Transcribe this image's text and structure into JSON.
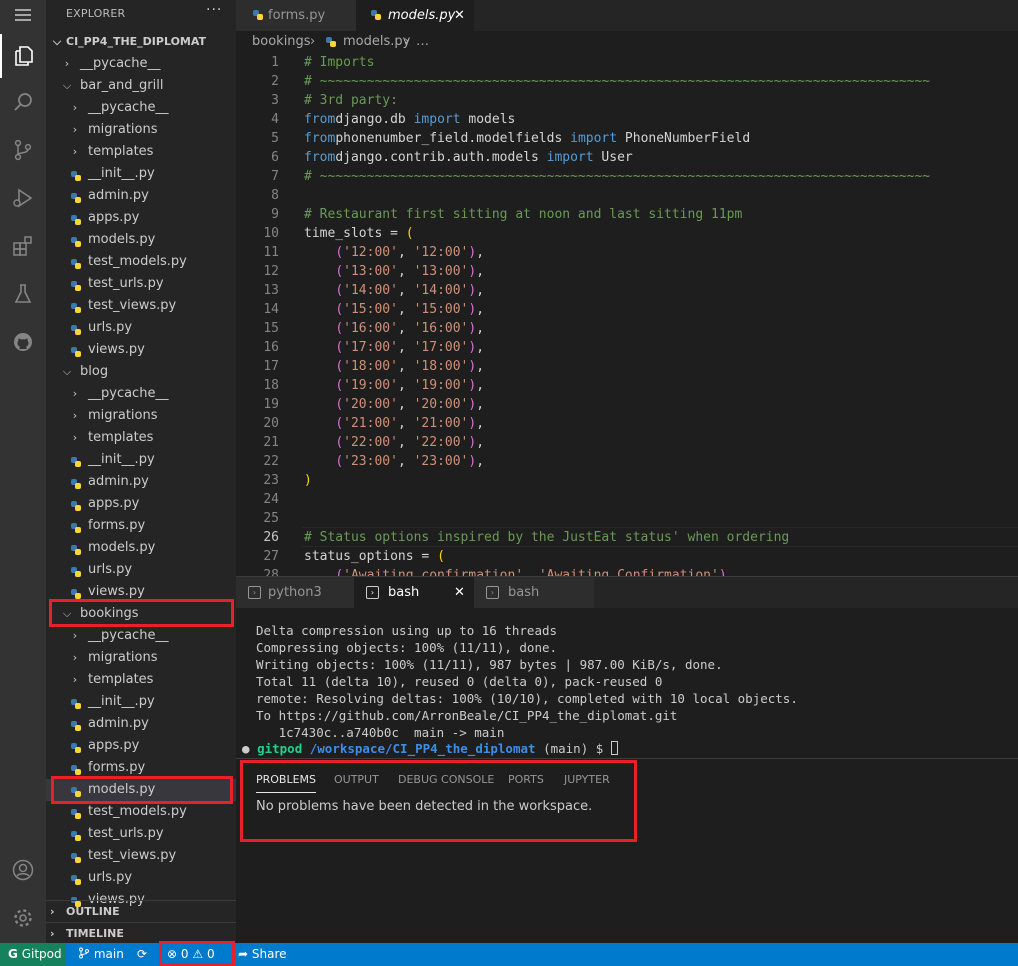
{
  "explorer": {
    "title": "EXPLORER",
    "more": "···",
    "root": "CI_PP4_THE_DIPLOMAT",
    "tree": [
      {
        "label": "__pycache__",
        "type": "folder",
        "open": false,
        "depth": 1
      },
      {
        "label": "bar_and_grill",
        "type": "folder",
        "open": true,
        "depth": 1
      },
      {
        "label": "__pycache__",
        "type": "folder",
        "open": false,
        "depth": 2
      },
      {
        "label": "migrations",
        "type": "folder",
        "open": false,
        "depth": 2
      },
      {
        "label": "templates",
        "type": "folder",
        "open": false,
        "depth": 2
      },
      {
        "label": "__init__.py",
        "type": "file",
        "depth": 2
      },
      {
        "label": "admin.py",
        "type": "file",
        "depth": 2
      },
      {
        "label": "apps.py",
        "type": "file",
        "depth": 2
      },
      {
        "label": "models.py",
        "type": "file",
        "depth": 2
      },
      {
        "label": "test_models.py",
        "type": "file",
        "depth": 2
      },
      {
        "label": "test_urls.py",
        "type": "file",
        "depth": 2
      },
      {
        "label": "test_views.py",
        "type": "file",
        "depth": 2
      },
      {
        "label": "urls.py",
        "type": "file",
        "depth": 2
      },
      {
        "label": "views.py",
        "type": "file",
        "depth": 2
      },
      {
        "label": "blog",
        "type": "folder",
        "open": true,
        "depth": 1
      },
      {
        "label": "__pycache__",
        "type": "folder",
        "open": false,
        "depth": 2
      },
      {
        "label": "migrations",
        "type": "folder",
        "open": false,
        "depth": 2
      },
      {
        "label": "templates",
        "type": "folder",
        "open": false,
        "depth": 2
      },
      {
        "label": "__init__.py",
        "type": "file",
        "depth": 2
      },
      {
        "label": "admin.py",
        "type": "file",
        "depth": 2
      },
      {
        "label": "apps.py",
        "type": "file",
        "depth": 2
      },
      {
        "label": "forms.py",
        "type": "file",
        "depth": 2
      },
      {
        "label": "models.py",
        "type": "file",
        "depth": 2
      },
      {
        "label": "urls.py",
        "type": "file",
        "depth": 2
      },
      {
        "label": "views.py",
        "type": "file",
        "depth": 2
      },
      {
        "label": "bookings",
        "type": "folder",
        "open": true,
        "depth": 1
      },
      {
        "label": "__pycache__",
        "type": "folder",
        "open": false,
        "depth": 2
      },
      {
        "label": "migrations",
        "type": "folder",
        "open": false,
        "depth": 2
      },
      {
        "label": "templates",
        "type": "folder",
        "open": false,
        "depth": 2
      },
      {
        "label": "__init__.py",
        "type": "file",
        "depth": 2
      },
      {
        "label": "admin.py",
        "type": "file",
        "depth": 2
      },
      {
        "label": "apps.py",
        "type": "file",
        "depth": 2
      },
      {
        "label": "forms.py",
        "type": "file",
        "depth": 2
      },
      {
        "label": "models.py",
        "type": "file",
        "depth": 2,
        "selected": true
      },
      {
        "label": "test_models.py",
        "type": "file",
        "depth": 2
      },
      {
        "label": "test_urls.py",
        "type": "file",
        "depth": 2
      },
      {
        "label": "test_views.py",
        "type": "file",
        "depth": 2
      },
      {
        "label": "urls.py",
        "type": "file",
        "depth": 2
      },
      {
        "label": "views.py",
        "type": "file",
        "depth": 2
      }
    ],
    "outline": "OUTLINE",
    "timeline": "TIMELINE"
  },
  "tabs": [
    {
      "label": "forms.py",
      "active": false
    },
    {
      "label": "models.py",
      "active": true,
      "close": "✕"
    }
  ],
  "breadcrumb": {
    "folder": "bookings",
    "sep": "›",
    "file": "models.py",
    "more": "…"
  },
  "editor": {
    "lines": [
      {
        "n": "1",
        "tokens": [
          [
            "cm",
            "# Imports"
          ]
        ]
      },
      {
        "n": "2",
        "tokens": [
          [
            "cm",
            "# ~~~~~~~~~~~~~~~~~~~~~~~~~~~~~~~~~~~~~~~~~~~~~~~~~~~~~~~~~~~~~~~~~~~~~~~~~~~~~~"
          ]
        ]
      },
      {
        "n": "3",
        "tokens": [
          [
            "cm",
            "# 3rd party:"
          ]
        ]
      },
      {
        "n": "4",
        "tokens": [
          [
            "kw",
            "from"
          ],
          [
            "",
            "django.db "
          ],
          [
            "kw",
            "import"
          ],
          [
            "",
            " models"
          ]
        ]
      },
      {
        "n": "5",
        "tokens": [
          [
            "kw",
            "from"
          ],
          [
            "",
            "phonenumber_field.modelfields "
          ],
          [
            "kw",
            "import"
          ],
          [
            "",
            " PhoneNumberField"
          ]
        ]
      },
      {
        "n": "6",
        "tokens": [
          [
            "kw",
            "from"
          ],
          [
            "",
            "django.contrib.auth.models "
          ],
          [
            "kw",
            "import"
          ],
          [
            "",
            " User"
          ]
        ]
      },
      {
        "n": "7",
        "tokens": [
          [
            "cm",
            "# ~~~~~~~~~~~~~~~~~~~~~~~~~~~~~~~~~~~~~~~~~~~~~~~~~~~~~~~~~~~~~~~~~~~~~~~~~~~~~~"
          ]
        ]
      },
      {
        "n": "8",
        "tokens": []
      },
      {
        "n": "9",
        "tokens": [
          [
            "cm",
            "# Restaurant first sitting at noon and last sitting 11pm"
          ]
        ]
      },
      {
        "n": "10",
        "tokens": [
          [
            "",
            "time_slots = "
          ],
          [
            "py2",
            "("
          ]
        ]
      },
      {
        "n": "11",
        "tokens": [
          [
            "",
            "    "
          ],
          [
            "pu",
            "("
          ],
          [
            "st",
            "'12:00'"
          ],
          [
            "",
            ", "
          ],
          [
            "st",
            "'12:00'"
          ],
          [
            "pu",
            ")"
          ],
          [
            "",
            ","
          ]
        ]
      },
      {
        "n": "12",
        "tokens": [
          [
            "",
            "    "
          ],
          [
            "pu",
            "("
          ],
          [
            "st",
            "'13:00'"
          ],
          [
            "",
            ", "
          ],
          [
            "st",
            "'13:00'"
          ],
          [
            "pu",
            ")"
          ],
          [
            "",
            ","
          ]
        ]
      },
      {
        "n": "13",
        "tokens": [
          [
            "",
            "    "
          ],
          [
            "pu",
            "("
          ],
          [
            "st",
            "'14:00'"
          ],
          [
            "",
            ", "
          ],
          [
            "st",
            "'14:00'"
          ],
          [
            "pu",
            ")"
          ],
          [
            "",
            ","
          ]
        ]
      },
      {
        "n": "14",
        "tokens": [
          [
            "",
            "    "
          ],
          [
            "pu",
            "("
          ],
          [
            "st",
            "'15:00'"
          ],
          [
            "",
            ", "
          ],
          [
            "st",
            "'15:00'"
          ],
          [
            "pu",
            ")"
          ],
          [
            "",
            ","
          ]
        ]
      },
      {
        "n": "15",
        "tokens": [
          [
            "",
            "    "
          ],
          [
            "pu",
            "("
          ],
          [
            "st",
            "'16:00'"
          ],
          [
            "",
            ", "
          ],
          [
            "st",
            "'16:00'"
          ],
          [
            "pu",
            ")"
          ],
          [
            "",
            ","
          ]
        ]
      },
      {
        "n": "16",
        "tokens": [
          [
            "",
            "    "
          ],
          [
            "pu",
            "("
          ],
          [
            "st",
            "'17:00'"
          ],
          [
            "",
            ", "
          ],
          [
            "st",
            "'17:00'"
          ],
          [
            "pu",
            ")"
          ],
          [
            "",
            ","
          ]
        ]
      },
      {
        "n": "17",
        "tokens": [
          [
            "",
            "    "
          ],
          [
            "pu",
            "("
          ],
          [
            "st",
            "'18:00'"
          ],
          [
            "",
            ", "
          ],
          [
            "st",
            "'18:00'"
          ],
          [
            "pu",
            ")"
          ],
          [
            "",
            ","
          ]
        ]
      },
      {
        "n": "18",
        "tokens": [
          [
            "",
            "    "
          ],
          [
            "pu",
            "("
          ],
          [
            "st",
            "'19:00'"
          ],
          [
            "",
            ", "
          ],
          [
            "st",
            "'19:00'"
          ],
          [
            "pu",
            ")"
          ],
          [
            "",
            ","
          ]
        ]
      },
      {
        "n": "19",
        "tokens": [
          [
            "",
            "    "
          ],
          [
            "pu",
            "("
          ],
          [
            "st",
            "'20:00'"
          ],
          [
            "",
            ", "
          ],
          [
            "st",
            "'20:00'"
          ],
          [
            "pu",
            ")"
          ],
          [
            "",
            ","
          ]
        ]
      },
      {
        "n": "20",
        "tokens": [
          [
            "",
            "    "
          ],
          [
            "pu",
            "("
          ],
          [
            "st",
            "'21:00'"
          ],
          [
            "",
            ", "
          ],
          [
            "st",
            "'21:00'"
          ],
          [
            "pu",
            ")"
          ],
          [
            "",
            ","
          ]
        ]
      },
      {
        "n": "21",
        "tokens": [
          [
            "",
            "    "
          ],
          [
            "pu",
            "("
          ],
          [
            "st",
            "'22:00'"
          ],
          [
            "",
            ", "
          ],
          [
            "st",
            "'22:00'"
          ],
          [
            "pu",
            ")"
          ],
          [
            "",
            ","
          ]
        ]
      },
      {
        "n": "22",
        "tokens": [
          [
            "",
            "    "
          ],
          [
            "pu",
            "("
          ],
          [
            "st",
            "'23:00'"
          ],
          [
            "",
            ", "
          ],
          [
            "st",
            "'23:00'"
          ],
          [
            "pu",
            ")"
          ],
          [
            "",
            ","
          ]
        ]
      },
      {
        "n": "23",
        "tokens": [
          [
            "py2",
            ")"
          ]
        ]
      },
      {
        "n": "24",
        "tokens": []
      },
      {
        "n": "25",
        "tokens": []
      },
      {
        "n": "26",
        "tokens": [
          [
            "cm",
            "# Status options inspired by the JustEat status' when ordering"
          ]
        ]
      },
      {
        "n": "27",
        "tokens": [
          [
            "",
            "status_options = "
          ],
          [
            "py2",
            "("
          ]
        ]
      },
      {
        "n": "28",
        "tokens": [
          [
            "",
            "    "
          ],
          [
            "pu",
            "("
          ],
          [
            "st",
            "'Awaiting confirmation'"
          ],
          [
            "",
            ", "
          ],
          [
            "st",
            "'Awaiting Confirmation'"
          ],
          [
            "pu",
            ")"
          ],
          [
            "",
            ","
          ]
        ]
      }
    ]
  },
  "terminal_tabs": [
    {
      "label": "python3",
      "active": false
    },
    {
      "label": "bash",
      "active": true,
      "close": "✕"
    },
    {
      "label": "bash",
      "active": false
    }
  ],
  "terminal": {
    "lines": [
      "Delta compression using up to 16 threads",
      "Compressing objects: 100% (11/11), done.",
      "Writing objects: 100% (11/11), 987 bytes | 987.00 KiB/s, done.",
      "Total 11 (delta 10), reused 0 (delta 0), pack-reused 0",
      "remote: Resolving deltas: 100% (10/10), completed with 10 local objects.",
      "To https://github.com/ArronBeale/CI_PP4_the_diplomat.git",
      "   1c7430c..a740b0c  main -> main"
    ],
    "prompt_user": "gitpod",
    "prompt_path": "/workspace/CI_PP4_the_diplomat",
    "prompt_branch": "(main) $"
  },
  "panel": {
    "tabs": [
      "PROBLEMS",
      "OUTPUT",
      "DEBUG CONSOLE",
      "PORTS",
      "JUPYTER"
    ],
    "message": "No problems have been detected in the workspace."
  },
  "status": {
    "remote": "Gitpod",
    "branch": "main",
    "errors": "0",
    "warnings": "0",
    "share": "Share"
  },
  "colors": {
    "accent": "#007acc",
    "highlight": "#e8202a"
  }
}
